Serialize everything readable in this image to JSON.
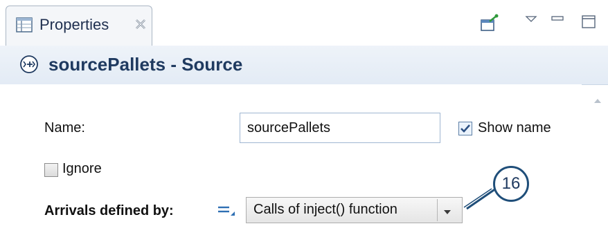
{
  "tab": {
    "title": "Properties"
  },
  "header": {
    "title": "sourcePallets - Source"
  },
  "form": {
    "name_label": "Name:",
    "name_value": "sourcePallets",
    "show_name_label": "Show name",
    "show_name_checked": true,
    "ignore_label": "Ignore",
    "ignore_checked": false,
    "arrivals_label": "Arrivals defined by:",
    "arrivals_value": "Calls of inject() function"
  },
  "callout": {
    "number": "16"
  },
  "colors": {
    "accent": "#1f4e79",
    "header_bg": "#e6edf6",
    "input_border": "#9fb6d1"
  },
  "icons": [
    "properties-view-icon",
    "close-icon",
    "pin-icon",
    "view-menu-icon",
    "minimize-icon",
    "maximize-icon",
    "source-block-icon",
    "scroll-up-icon",
    "checkmark-icon",
    "dynamic-value-icon",
    "chevron-down-icon"
  ]
}
